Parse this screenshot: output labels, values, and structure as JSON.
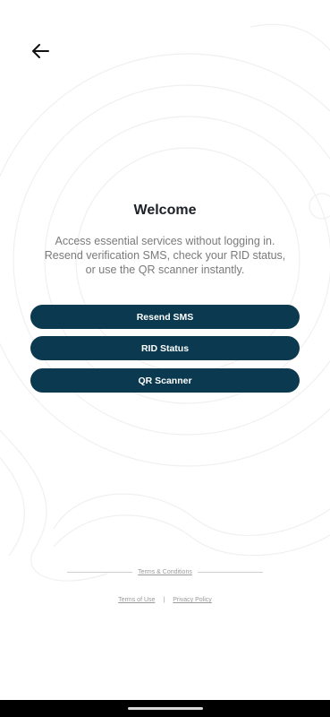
{
  "header": {
    "back_icon": "arrow-left-icon"
  },
  "main": {
    "title": "Welcome",
    "description": "Access essential services without logging in. Resend verification SMS, check your RID status, or use the QR scanner instantly.",
    "buttons": [
      {
        "label": "Resend SMS"
      },
      {
        "label": "RID Status"
      },
      {
        "label": "QR Scanner"
      }
    ]
  },
  "footer": {
    "terms_conditions": "Terms & Conditions",
    "terms_of_use": "Terms of Use",
    "separator": "|",
    "privacy_policy": "Privacy Policy"
  },
  "colors": {
    "primary": "#0b3a50",
    "title": "#1c2127",
    "muted": "#7a7a7a",
    "background": "#ffffff"
  }
}
